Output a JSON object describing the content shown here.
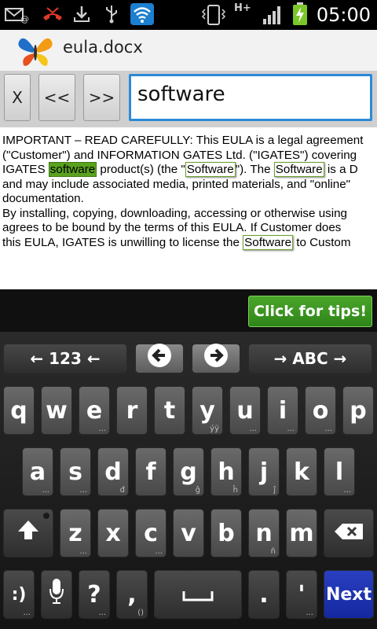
{
  "status_bar": {
    "time": "05:00",
    "network_label": "H+",
    "icons": [
      "gmail-icon",
      "missed-call-icon",
      "download-icon",
      "usb-icon",
      "wifi-icon",
      "vibrate-icon",
      "signal-icon",
      "battery-charging-icon"
    ]
  },
  "app": {
    "title": "eula.docx"
  },
  "search": {
    "close_label": "X",
    "prev_label": "<<",
    "next_label": ">>",
    "query": "software"
  },
  "document": {
    "lines": [
      [
        "IMPORTANT – READ CAREFULLY: This EULA is a legal agreement"
      ],
      [
        "(\"Customer\") and INFORMATION GATES Ltd. (\"IGATES\") covering"
      ],
      [
        "IGATES ",
        {
          "hl": "software",
          "active": true
        },
        " product(s) (the \"",
        {
          "hl": "Software"
        },
        "\"). The ",
        {
          "hl": "Software"
        },
        " is a D"
      ],
      [
        "and may include associated media, printed materials, and \"online\""
      ],
      [
        "documentation."
      ],
      [
        "By installing, copying, downloading, accessing or otherwise using"
      ],
      [
        "agrees to be bound by the terms of this EULA. If Customer does"
      ],
      [
        "this EULA, IGATES is unwilling to license the ",
        {
          "hl": "Software"
        },
        " to Custom"
      ]
    ]
  },
  "tips": {
    "label": "Click for tips!"
  },
  "keyboard": {
    "mode_left": "← 123 ←",
    "mode_right": "→ ABC →",
    "row1": [
      {
        "k": "q",
        "s": ""
      },
      {
        "k": "w",
        "s": ""
      },
      {
        "k": "e",
        "s": "..."
      },
      {
        "k": "r",
        "s": ""
      },
      {
        "k": "t",
        "s": ""
      },
      {
        "k": "y",
        "s": "ýÿ"
      },
      {
        "k": "u",
        "s": "..."
      },
      {
        "k": "i",
        "s": "..."
      },
      {
        "k": "o",
        "s": "..."
      },
      {
        "k": "p",
        "s": ""
      }
    ],
    "row2": [
      {
        "k": "a",
        "s": "..."
      },
      {
        "k": "s",
        "s": "..."
      },
      {
        "k": "d",
        "s": "đ"
      },
      {
        "k": "f",
        "s": ""
      },
      {
        "k": "g",
        "s": "ĝ"
      },
      {
        "k": "h",
        "s": "ĥ"
      },
      {
        "k": "j",
        "s": "ĵ"
      },
      {
        "k": "k",
        "s": ""
      },
      {
        "k": "l",
        "s": "..."
      }
    ],
    "row3": [
      {
        "k": "z",
        "s": "..."
      },
      {
        "k": "x",
        "s": ""
      },
      {
        "k": "c",
        "s": "..."
      },
      {
        "k": "v",
        "s": ""
      },
      {
        "k": "b",
        "s": ""
      },
      {
        "k": "n",
        "s": "ñ"
      },
      {
        "k": "m",
        "s": ""
      }
    ],
    "question_label": "?",
    "question_sub": "...",
    "comma_label": ",",
    "comma_sub": "()",
    "period_label": ".",
    "apostrophe_label": "'",
    "apostrophe_sub": "...",
    "next_label": "Next"
  },
  "colors": {
    "accent_blue": "#2a8ad8",
    "highlight_green": "#5aa21e",
    "tips_green": "#3a9a22",
    "next_blue": "#1a30b0"
  }
}
